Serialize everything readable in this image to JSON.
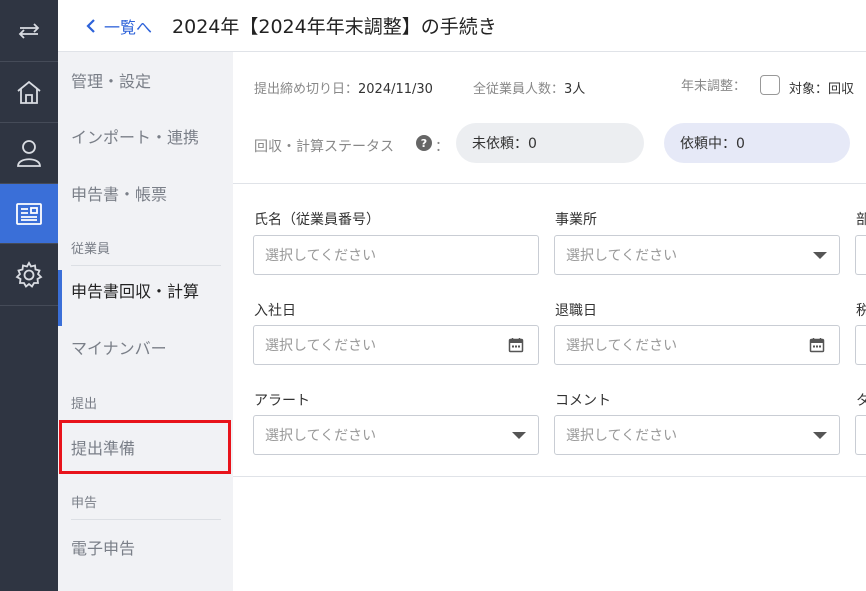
{
  "rail": {
    "items": [
      {
        "icon": "swap-arrows-icon"
      },
      {
        "icon": "home-icon"
      },
      {
        "icon": "person-icon"
      },
      {
        "icon": "document-icon"
      },
      {
        "icon": "gear-icon"
      }
    ],
    "accent": "#3a6fd8"
  },
  "header": {
    "back_label": "一覧へ",
    "title": "2024年【2024年年末調整】の手続き"
  },
  "subnav": {
    "items": {
      "admin": "管理・設定",
      "import": "インポート・連携",
      "forms": "申告書・帳票",
      "section_employees": "従業員",
      "collect": "申告書回収・計算",
      "mynumber": "マイナンバー",
      "section_submit": "提出",
      "prepare": "提出準備",
      "section_filing": "申告",
      "efiling": "電子申告"
    }
  },
  "summary": {
    "deadline_label": "提出締め切り日：",
    "deadline_value": "2024/11/30",
    "employees_label": "全従業員人数：",
    "employees_value": "3人",
    "adjust_label": "年末調整：",
    "target_label": "対象：回収",
    "status_label": "回収・計算ステータス",
    "status_colon": "：",
    "help_glyph": "?",
    "not_requested": "未依頼：0",
    "requested": "依頼中：0"
  },
  "filters": {
    "name_label": "氏名（従業員番号）",
    "name_placeholder": "選択してください",
    "office_label": "事業所",
    "office_placeholder": "選択してください",
    "dept_label_partial": "部",
    "hire_label": "入社日",
    "hire_placeholder": "選択してください",
    "leave_label": "退職日",
    "leave_placeholder": "選択してください",
    "tax_label_partial": "税",
    "alert_label": "アラート",
    "alert_placeholder": "選択してください",
    "comment_label": "コメント",
    "comment_placeholder": "選択してください",
    "tag_label_partial": "タ"
  }
}
